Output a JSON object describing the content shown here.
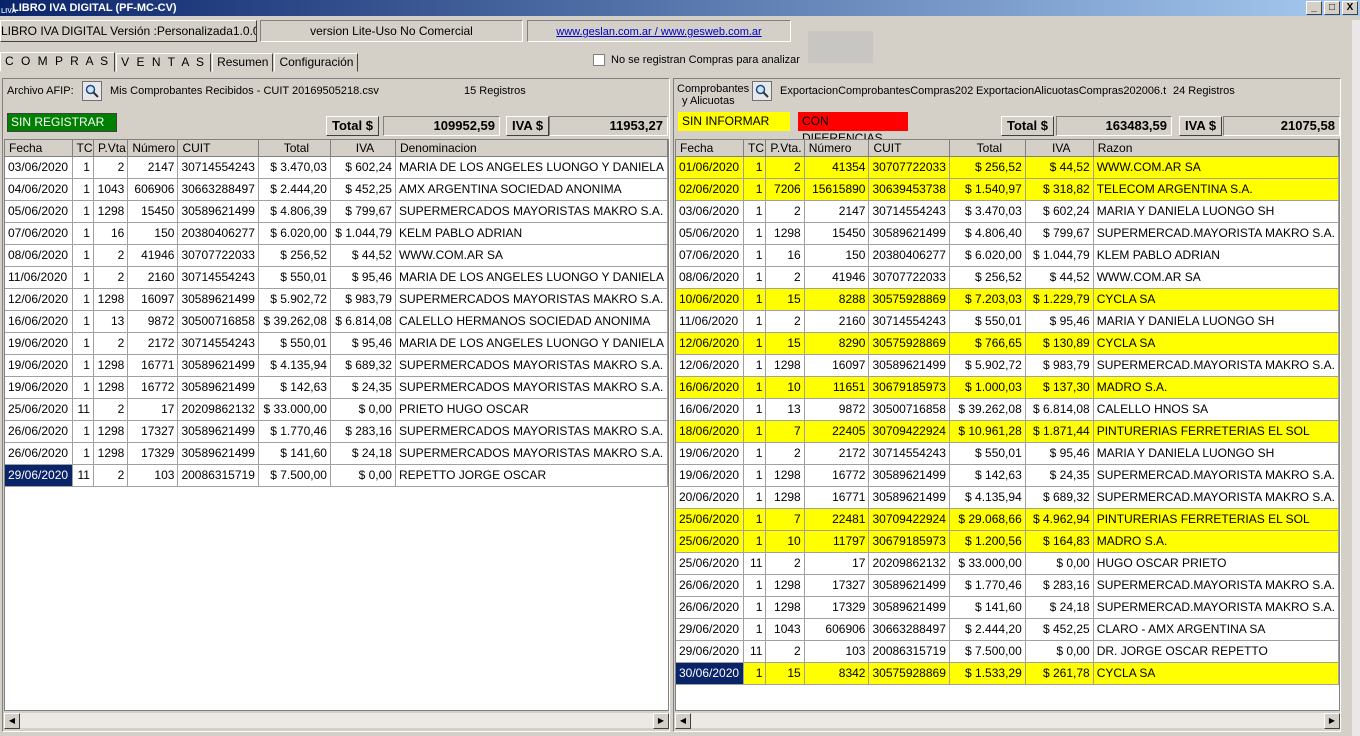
{
  "window": {
    "title": "LIBRO IVA DIGITAL (PF-MC-CV)",
    "app_icon": "LIVA",
    "minimize": "_",
    "maximize": "□",
    "close": "X"
  },
  "info": {
    "version": "LIBRO IVA DIGITAL Versión :Personalizada1.0.0.0",
    "license": "version Lite-Uso No Comercial",
    "links": "www.geslan.com.ar / www.gesweb.com.ar"
  },
  "tabs": [
    "C O M P R A S",
    "V E N T A S",
    "Resumen",
    "Configuración"
  ],
  "no_compras_label": "No se registran Compras para analizar",
  "left": {
    "archivo_label": "Archivo AFIP:",
    "filename": "Mis Comprobantes Recibidos - CUIT 20169505218.csv",
    "registros": "15 Registros",
    "badge": "SIN REGISTRAR",
    "total_label": "Total $",
    "total": "109952,59",
    "iva_label": "IVA $",
    "iva": "11953,27",
    "columns": [
      "Fecha",
      "TC",
      "P.Vta",
      "Número",
      "CUIT",
      "Total",
      "IVA",
      "Denominacion"
    ],
    "rows": [
      [
        "03/06/2020",
        "1",
        "2",
        "2147",
        "30714554243",
        "$ 3.470,03",
        "$ 602,24",
        "MARIA DE LOS ANGELES LUONGO Y DANIELA"
      ],
      [
        "04/06/2020",
        "1",
        "1043",
        "606906",
        "30663288497",
        "$ 2.444,20",
        "$ 452,25",
        "AMX ARGENTINA SOCIEDAD ANONIMA"
      ],
      [
        "05/06/2020",
        "1",
        "1298",
        "15450",
        "30589621499",
        "$ 4.806,39",
        "$ 799,67",
        "SUPERMERCADOS MAYORISTAS MAKRO S.A."
      ],
      [
        "07/06/2020",
        "1",
        "16",
        "150",
        "20380406277",
        "$ 6.020,00",
        "$ 1.044,79",
        "KELM PABLO ADRIAN"
      ],
      [
        "08/06/2020",
        "1",
        "2",
        "41946",
        "30707722033",
        "$ 256,52",
        "$ 44,52",
        "WWW.COM.AR SA"
      ],
      [
        "11/06/2020",
        "1",
        "2",
        "2160",
        "30714554243",
        "$ 550,01",
        "$ 95,46",
        "MARIA DE LOS ANGELES LUONGO Y DANIELA"
      ],
      [
        "12/06/2020",
        "1",
        "1298",
        "16097",
        "30589621499",
        "$ 5.902,72",
        "$ 983,79",
        "SUPERMERCADOS MAYORISTAS MAKRO S.A."
      ],
      [
        "16/06/2020",
        "1",
        "13",
        "9872",
        "30500716858",
        "$ 39.262,08",
        "$ 6.814,08",
        "CALELLO HERMANOS SOCIEDAD ANONIMA"
      ],
      [
        "19/06/2020",
        "1",
        "2",
        "2172",
        "30714554243",
        "$ 550,01",
        "$ 95,46",
        "MARIA DE LOS ANGELES LUONGO Y DANIELA"
      ],
      [
        "19/06/2020",
        "1",
        "1298",
        "16771",
        "30589621499",
        "$ 4.135,94",
        "$ 689,32",
        "SUPERMERCADOS MAYORISTAS MAKRO S.A."
      ],
      [
        "19/06/2020",
        "1",
        "1298",
        "16772",
        "30589621499",
        "$ 142,63",
        "$ 24,35",
        "SUPERMERCADOS MAYORISTAS MAKRO S.A."
      ],
      [
        "25/06/2020",
        "11",
        "2",
        "17",
        "20209862132",
        "$ 33.000,00",
        "$ 0,00",
        "PRIETO HUGO OSCAR"
      ],
      [
        "26/06/2020",
        "1",
        "1298",
        "17327",
        "30589621499",
        "$ 1.770,46",
        "$ 283,16",
        "SUPERMERCADOS MAYORISTAS MAKRO S.A."
      ],
      [
        "26/06/2020",
        "1",
        "1298",
        "17329",
        "30589621499",
        "$ 141,60",
        "$ 24,18",
        "SUPERMERCADOS MAYORISTAS MAKRO S.A."
      ],
      [
        "29/06/2020",
        "11",
        "2",
        "103",
        "20086315719",
        "$ 7.500,00",
        "$ 0,00",
        "REPETTO JORGE OSCAR"
      ]
    ]
  },
  "right": {
    "comp_label_1": "Comprobantes",
    "comp_label_2": "y Alicuotas",
    "file1": "ExportacionComprobantesCompras202",
    "file2": "ExportacionAlicuotasCompras202006.t",
    "registros": "24 Registros",
    "badge_yellow": "SIN INFORMAR",
    "badge_red": "CON DIFERENCIAS",
    "total_label": "Total $",
    "total": "163483,59",
    "iva_label": "IVA $",
    "iva": "21075,58",
    "columns": [
      "Fecha",
      "TC",
      "P.Vta.",
      "Número",
      "CUIT",
      "Total",
      "IVA",
      "Razon"
    ],
    "rows": [
      [
        "01/06/2020",
        "1",
        "2",
        "41354",
        "30707722033",
        "$ 256,52",
        "$ 44,52",
        "WWW.COM.AR SA",
        "y"
      ],
      [
        "02/06/2020",
        "1",
        "7206",
        "15615890",
        "30639453738",
        "$ 1.540,97",
        "$ 318,82",
        "TELECOM ARGENTINA S.A.",
        "y"
      ],
      [
        "03/06/2020",
        "1",
        "2",
        "2147",
        "30714554243",
        "$ 3.470,03",
        "$ 602,24",
        "MARIA Y DANIELA LUONGO SH",
        ""
      ],
      [
        "05/06/2020",
        "1",
        "1298",
        "15450",
        "30589621499",
        "$ 4.806,40",
        "$ 799,67",
        "SUPERMERCAD.MAYORISTA MAKRO S.A.",
        ""
      ],
      [
        "07/06/2020",
        "1",
        "16",
        "150",
        "20380406277",
        "$ 6.020,00",
        "$ 1.044,79",
        "KLEM PABLO ADRIAN",
        ""
      ],
      [
        "08/06/2020",
        "1",
        "2",
        "41946",
        "30707722033",
        "$ 256,52",
        "$ 44,52",
        "WWW.COM.AR SA",
        ""
      ],
      [
        "10/06/2020",
        "1",
        "15",
        "8288",
        "30575928869",
        "$ 7.203,03",
        "$ 1.229,79",
        "CYCLA SA",
        "y"
      ],
      [
        "11/06/2020",
        "1",
        "2",
        "2160",
        "30714554243",
        "$ 550,01",
        "$ 95,46",
        "MARIA Y DANIELA LUONGO SH",
        ""
      ],
      [
        "12/06/2020",
        "1",
        "15",
        "8290",
        "30575928869",
        "$ 766,65",
        "$ 130,89",
        "CYCLA SA",
        "y"
      ],
      [
        "12/06/2020",
        "1",
        "1298",
        "16097",
        "30589621499",
        "$ 5.902,72",
        "$ 983,79",
        "SUPERMERCAD.MAYORISTA MAKRO S.A.",
        ""
      ],
      [
        "16/06/2020",
        "1",
        "10",
        "11651",
        "30679185973",
        "$ 1.000,03",
        "$ 137,30",
        "MADRO S.A.",
        "y"
      ],
      [
        "16/06/2020",
        "1",
        "13",
        "9872",
        "30500716858",
        "$ 39.262,08",
        "$ 6.814,08",
        "CALELLO HNOS SA",
        ""
      ],
      [
        "18/06/2020",
        "1",
        "7",
        "22405",
        "30709422924",
        "$ 10.961,28",
        "$ 1.871,44",
        "PINTURERIAS FERRETERIAS EL SOL",
        "y"
      ],
      [
        "19/06/2020",
        "1",
        "2",
        "2172",
        "30714554243",
        "$ 550,01",
        "$ 95,46",
        "MARIA Y DANIELA LUONGO SH",
        ""
      ],
      [
        "19/06/2020",
        "1",
        "1298",
        "16772",
        "30589621499",
        "$ 142,63",
        "$ 24,35",
        "SUPERMERCAD.MAYORISTA MAKRO S.A.",
        ""
      ],
      [
        "20/06/2020",
        "1",
        "1298",
        "16771",
        "30589621499",
        "$ 4.135,94",
        "$ 689,32",
        "SUPERMERCAD.MAYORISTA MAKRO S.A.",
        ""
      ],
      [
        "25/06/2020",
        "1",
        "7",
        "22481",
        "30709422924",
        "$ 29.068,66",
        "$ 4.962,94",
        "PINTURERIAS FERRETERIAS EL SOL",
        "y"
      ],
      [
        "25/06/2020",
        "1",
        "10",
        "11797",
        "30679185973",
        "$ 1.200,56",
        "$ 164,83",
        "MADRO S.A.",
        "y"
      ],
      [
        "25/06/2020",
        "11",
        "2",
        "17",
        "20209862132",
        "$ 33.000,00",
        "$ 0,00",
        "HUGO OSCAR PRIETO",
        ""
      ],
      [
        "26/06/2020",
        "1",
        "1298",
        "17327",
        "30589621499",
        "$ 1.770,46",
        "$ 283,16",
        "SUPERMERCAD.MAYORISTA MAKRO S.A.",
        ""
      ],
      [
        "26/06/2020",
        "1",
        "1298",
        "17329",
        "30589621499",
        "$ 141,60",
        "$ 24,18",
        "SUPERMERCAD.MAYORISTA MAKRO S.A.",
        ""
      ],
      [
        "29/06/2020",
        "1",
        "1043",
        "606906",
        "30663288497",
        "$ 2.444,20",
        "$ 452,25",
        "CLARO - AMX ARGENTINA SA",
        ""
      ],
      [
        "29/06/2020",
        "11",
        "2",
        "103",
        "20086315719",
        "$ 7.500,00",
        "$ 0,00",
        "DR. JORGE OSCAR REPETTO",
        ""
      ],
      [
        "30/06/2020",
        "1",
        "15",
        "8342",
        "30575928869",
        "$ 1.533,29",
        "$ 261,78",
        "CYCLA SA",
        "y"
      ]
    ]
  },
  "colors": {
    "sin_registrar": "#008000",
    "sin_informar": "#ffff00",
    "con_diferencias": "#ff0000",
    "selection": "#0a246a"
  }
}
